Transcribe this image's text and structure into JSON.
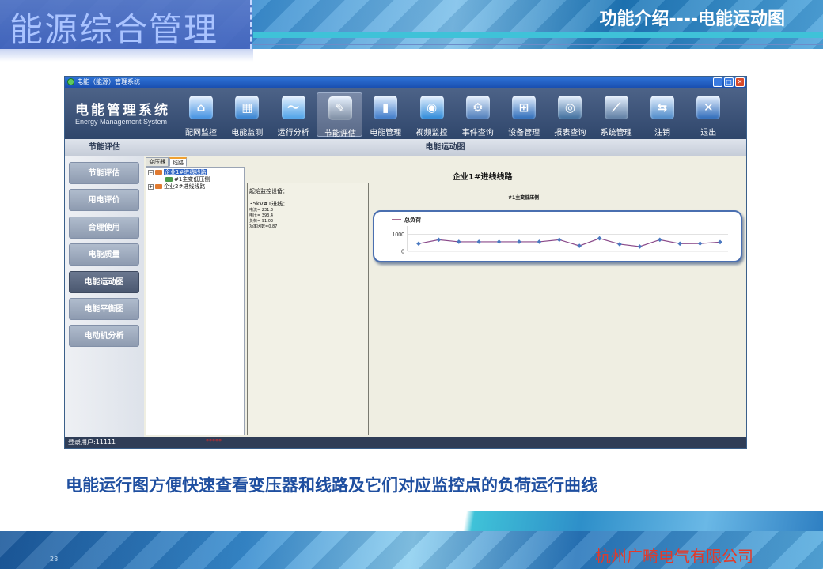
{
  "slide": {
    "title": "能源综合管理",
    "section_title": "功能介绍----电能运动图",
    "caption": "电能运行图方便快速查看变压器和线路及它们对应监控点的负荷运行曲线",
    "company": "杭州广畸电气有限公司",
    "page_number": "28"
  },
  "window": {
    "title": "电能（能源）管理系统",
    "brand_name": "电能管理系统",
    "brand_subtitle": "Energy Management System"
  },
  "nav": [
    {
      "label": "配网监控",
      "icon": "home-icon",
      "glyph": "⌂",
      "color": "#3f8fe0"
    },
    {
      "label": "电能监测",
      "icon": "monitor-icon",
      "glyph": "▦",
      "color": "#2f7fd0"
    },
    {
      "label": "运行分析",
      "icon": "line-chart-icon",
      "glyph": "〜",
      "color": "#4aa0e8"
    },
    {
      "label": "节能评估",
      "icon": "clipboard-icon",
      "glyph": "✎",
      "color": "#7a8aa0"
    },
    {
      "label": "电能管理",
      "icon": "battery-icon",
      "glyph": "▮",
      "color": "#3a78c8"
    },
    {
      "label": "视频监控",
      "icon": "camera-icon",
      "glyph": "◉",
      "color": "#2a88d8"
    },
    {
      "label": "事件查询",
      "icon": "search-event-icon",
      "glyph": "⚙",
      "color": "#4a7ab8"
    },
    {
      "label": "设备管理",
      "icon": "device-icon",
      "glyph": "⊞",
      "color": "#2a6ab8"
    },
    {
      "label": "报表查询",
      "icon": "report-icon",
      "glyph": "◎",
      "color": "#3a6a9a"
    },
    {
      "label": "系统管理",
      "icon": "tools-icon",
      "glyph": "⟋",
      "color": "#5a7aa0"
    },
    {
      "label": "注销",
      "icon": "logout-icon",
      "glyph": "⇆",
      "color": "#4a88c8"
    },
    {
      "label": "退出",
      "icon": "exit-icon",
      "glyph": "✕",
      "color": "#2a68b8"
    }
  ],
  "nav_active_index": 3,
  "sidebar": {
    "header": "节能评估",
    "items": [
      "节能评估",
      "用电评价",
      "合理使用",
      "电能质量",
      "电能运动图",
      "电能平衡图",
      "电动机分析"
    ],
    "active_index": 4
  },
  "content": {
    "header": "电能运动图",
    "tabs": [
      "变压器",
      "线路"
    ],
    "active_tab": 1,
    "tree": [
      {
        "label": "企业1#进线线路",
        "expander": "⊟",
        "selected": true
      },
      {
        "label": "#1主变低压侧",
        "expander": "",
        "selected": false
      },
      {
        "label": "企业2#进线线路",
        "expander": "⊞",
        "selected": false
      }
    ],
    "info": {
      "heading": "起始监控设备：",
      "device": "35kV#1进线：",
      "current": "电流= 231.3",
      "voltage": "电压= 393.4",
      "load": "负荷= 91.03",
      "power_factor": "功率因数=0.87"
    }
  },
  "chart_data": {
    "type": "line",
    "title": "企业1#进线线路",
    "subtitle": "#1主变低压侧",
    "series": [
      {
        "name": "总负荷",
        "color": "#4a4a9a",
        "values": [
          450,
          680,
          560,
          560,
          560,
          560,
          560,
          680,
          320,
          760,
          420,
          280,
          680,
          450,
          460,
          540
        ]
      }
    ],
    "yticks": [
      0,
      1000
    ],
    "ylim": [
      0,
      1300
    ],
    "grid": true
  },
  "status": {
    "user": "登录用户:11111",
    "alert": "*****"
  }
}
